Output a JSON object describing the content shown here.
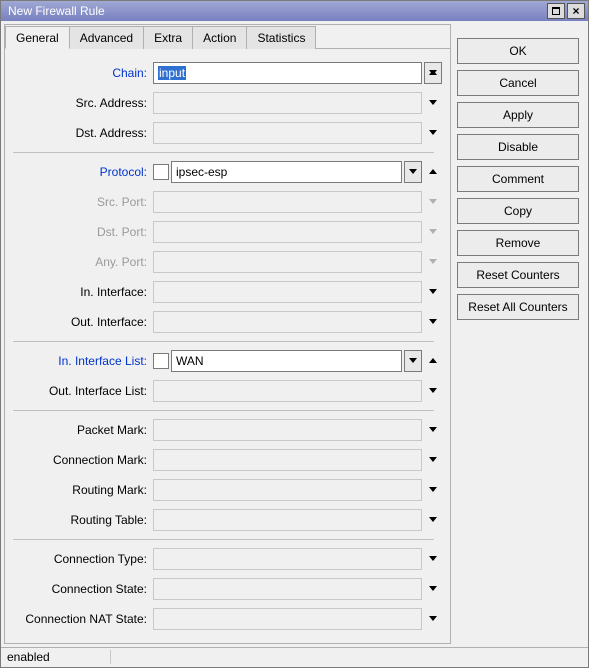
{
  "window": {
    "title": "New Firewall Rule"
  },
  "tabs": {
    "general": "General",
    "advanced": "Advanced",
    "extra": "Extra",
    "action": "Action",
    "statistics": "Statistics"
  },
  "labels": {
    "chain": "Chain:",
    "srcaddr": "Src. Address:",
    "dstaddr": "Dst. Address:",
    "protocol": "Protocol:",
    "srcport": "Src. Port:",
    "dstport": "Dst. Port:",
    "anyport": "Any. Port:",
    "inif": "In. Interface:",
    "outif": "Out. Interface:",
    "iniflist": "In. Interface List:",
    "outiflist": "Out. Interface List:",
    "pktmark": "Packet Mark:",
    "connmark": "Connection Mark:",
    "routemark": "Routing Mark:",
    "routetbl": "Routing Table:",
    "conntype": "Connection Type:",
    "connstate": "Connection State:",
    "connnat": "Connection NAT State:"
  },
  "values": {
    "chain": "input",
    "protocol": "ipsec-esp",
    "iniflist": "WAN"
  },
  "buttons": {
    "ok": "OK",
    "cancel": "Cancel",
    "apply": "Apply",
    "disable": "Disable",
    "comment": "Comment",
    "copy": "Copy",
    "remove": "Remove",
    "resetcounters": "Reset Counters",
    "resetall": "Reset All Counters"
  },
  "status": {
    "text": "enabled"
  }
}
